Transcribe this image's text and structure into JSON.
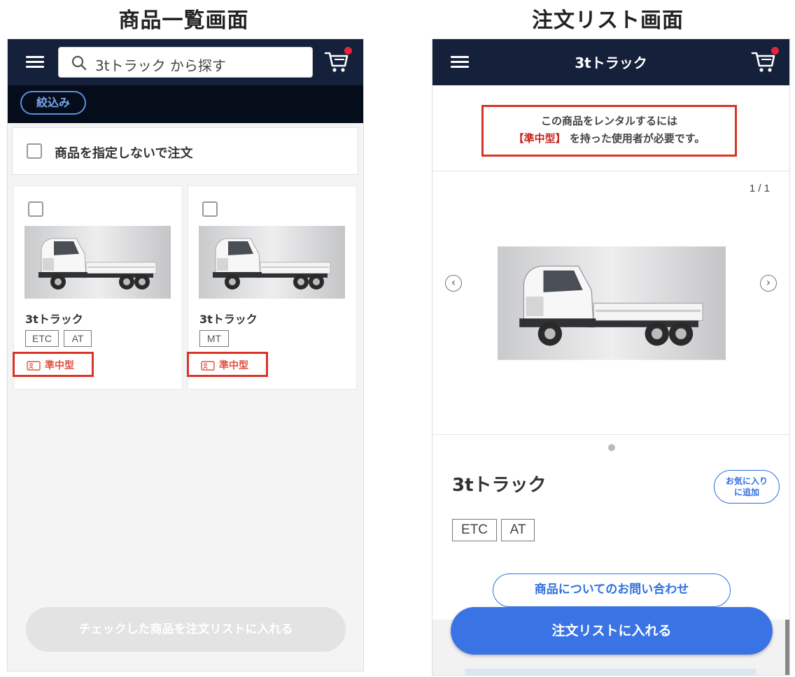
{
  "left_screen": {
    "title": "商品一覧画面",
    "search": {
      "placeholder": "3tトラック から探す"
    },
    "filter_label": "絞込み",
    "no_spec_label": "商品を指定しないで注文",
    "cards": [
      {
        "name": "3tトラック",
        "tags": [
          "ETC",
          "AT"
        ],
        "license": "準中型"
      },
      {
        "name": "3tトラック",
        "tags": [
          "MT"
        ],
        "license": "準中型"
      }
    ],
    "bottom_button": "チェックした商品を注文リストに入れる"
  },
  "right_screen": {
    "title": "注文リスト画面",
    "header_title": "3tトラック",
    "notice_line1": "この商品をレンタルするには",
    "notice_license": "【準中型】",
    "notice_line2_rest": " を持った使用者が必要です。",
    "counter": "1 / 1",
    "product_name": "3tトラック",
    "favorite_line1": "お気に入り",
    "favorite_line2": "に追加",
    "tags": [
      "ETC",
      "AT"
    ],
    "inquiry_button": "商品についてのお問い合わせ",
    "order_button": "注文リストに入れる"
  },
  "colors": {
    "header": "#15203a",
    "filter_bar": "#060d1a",
    "accent_blue": "#3a74e4",
    "highlight_red": "#d73526",
    "cart_badge": "#e8223c"
  },
  "icons": [
    "menu-icon",
    "search-icon",
    "cart-icon",
    "license-icon",
    "chevron-left-icon",
    "chevron-right-icon"
  ]
}
